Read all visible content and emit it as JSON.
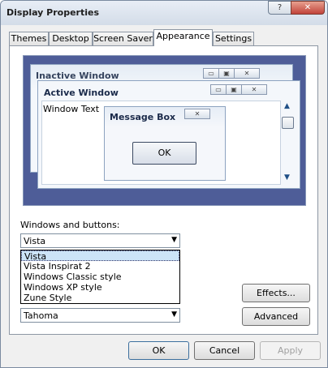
{
  "window": {
    "title": "Display Properties",
    "help_glyph": "?",
    "close_glyph": "✕"
  },
  "tabs": [
    {
      "label": "Themes"
    },
    {
      "label": "Desktop"
    },
    {
      "label": "Screen Saver"
    },
    {
      "label": "Appearance"
    },
    {
      "label": "Settings"
    }
  ],
  "active_tab": "Appearance",
  "preview": {
    "inactive_window_title": "Inactive Window",
    "active_window_title": "Active Window",
    "window_text": "Window Text",
    "message_box_title": "Message Box",
    "message_box_ok": "OK",
    "min_glyph": "▭",
    "max_glyph": "▣",
    "close_glyph": "✕",
    "scroll_up_glyph": "▲",
    "scroll_down_glyph": "▼"
  },
  "windows_and_buttons": {
    "label": "Windows and buttons:",
    "selected": "Vista",
    "options": [
      "Vista",
      "Vista Inspirat 2",
      "Windows Classic style",
      "Windows XP style",
      "Zune Style"
    ],
    "dropdown_glyph": "▼"
  },
  "font_size_select": {
    "selected": "Tahoma",
    "dropdown_glyph": "▼"
  },
  "side_buttons": {
    "effects": "Effects...",
    "advanced": "Advanced"
  },
  "dialog_buttons": {
    "ok": "OK",
    "cancel": "Cancel",
    "apply": "Apply"
  },
  "colors": {
    "preview_bg": "#4e5d98",
    "selection": "#cce4f7",
    "close_button": "#c1433a"
  }
}
